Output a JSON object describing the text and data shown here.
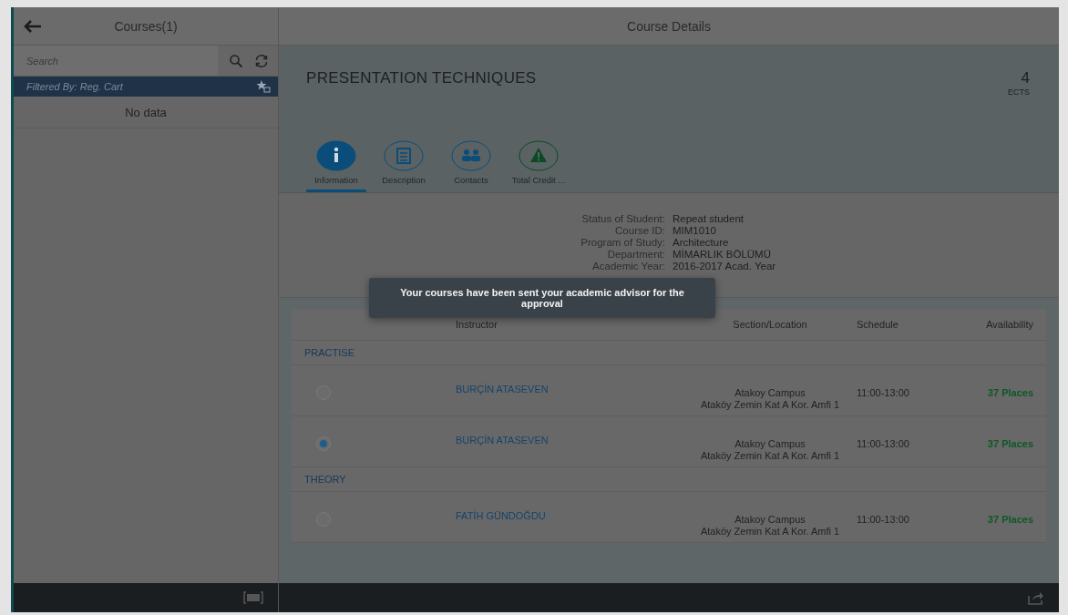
{
  "master": {
    "title": "Courses(1)",
    "search": {
      "placeholder": "Search"
    },
    "filter": "Filtered By: Reg. Cart",
    "empty_text": "No data"
  },
  "detail": {
    "title": "Course Details",
    "course_name": "PRESENTATION TECHNIQUES",
    "credits": "4",
    "credits_unit": "ECTS",
    "tabs": [
      {
        "label": "Information",
        "kind": "info",
        "selected": true
      },
      {
        "label": "Description",
        "kind": "description",
        "selected": false
      },
      {
        "label": "Contacts",
        "kind": "contacts",
        "selected": false
      },
      {
        "label": "Total Credit ...",
        "kind": "warning",
        "selected": false
      }
    ],
    "info": [
      {
        "label": "Status of Student:",
        "value": "Repeat student"
      },
      {
        "label": "Course ID:",
        "value": "MIM1010"
      },
      {
        "label": "Program of Study:",
        "value": "Architecture"
      },
      {
        "label": "Department:",
        "value": "MİMARLIK BÖLÜMÜ"
      },
      {
        "label": "Academic Year:",
        "value": "2016-2017 Acad. Year"
      }
    ],
    "table": {
      "columns": [
        "Instructor",
        "Section/Location",
        "Schedule",
        "Availability"
      ],
      "groups": [
        {
          "title": "PRACTISE",
          "rows": [
            {
              "selected": false,
              "instructor": "BURÇİN ATASEVEN",
              "campus": "Atakoy Campus",
              "room": "Ataköy Zemin Kat A Kor. Amfi 1",
              "schedule": "11:00-13:00",
              "availability": "37 Places"
            },
            {
              "selected": true,
              "instructor": "BURÇİN ATASEVEN",
              "campus": "Atakoy Campus",
              "room": "Ataköy Zemin Kat A Kor. Amfi 1",
              "schedule": "11:00-13:00",
              "availability": "37 Places"
            }
          ]
        },
        {
          "title": "THEORY",
          "rows": [
            {
              "selected": false,
              "instructor": "FATİH GÜNDOĞDU",
              "campus": "Atakoy Campus",
              "room": "Ataköy Zemin Kat A Kor. Amfi 1",
              "schedule": "11:00-13:00",
              "availability": "37 Places"
            }
          ]
        }
      ]
    }
  },
  "toast": "Your courses have been sent your academic advisor for the approval"
}
